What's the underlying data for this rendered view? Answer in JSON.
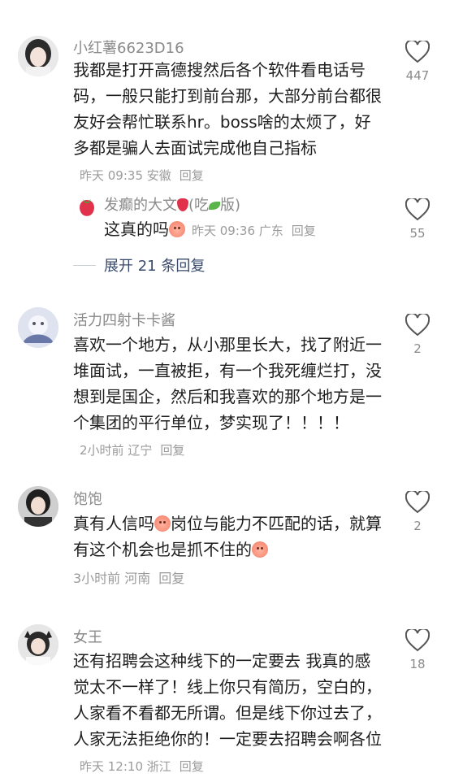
{
  "comments": [
    {
      "username": "小红薯6623D16",
      "text": "我都是打开高德搜然后各个软件看电话号码，一般只能打到前台那，大部分前台都很友好会帮忙联系hr。boss啥的太烦了，好多都是骗人去面试完成他自己指标",
      "time": "昨天 09:35",
      "location": "安徽",
      "reply_label": "回复",
      "likes": "447",
      "reply": {
        "username_prefix": "发癫的大文",
        "username_mid": "(吃",
        "username_suffix": "版)",
        "text": "这真的吗",
        "time": "昨天 09:36",
        "location": "广东",
        "reply_label": "回复",
        "likes": "55"
      },
      "expand_label": "展开 21 条回复"
    },
    {
      "username": "活力四射卡卡酱",
      "text": "喜欢一个地方，从小那里长大，找了附近一堆面试，一直被拒，有一个我死缠烂打，没想到是国企，然后和我喜欢的那个地方是一个集团的平行单位，梦实现了！！！！",
      "time": "2小时前",
      "location": "辽宁",
      "reply_label": "回复",
      "likes": "2"
    },
    {
      "username": "饱饱",
      "text_a": "真有人信吗",
      "text_b": "岗位与能力不匹配的话，就算有这个机会也是抓不住的",
      "time": "3小时前",
      "location": "河南",
      "reply_label": "回复",
      "likes": "2"
    },
    {
      "username": "女王",
      "text": "还有招聘会这种线下的一定要去 我真的感觉太不一样了！线上你只有简历，空白的，人家看不看都无所谓。但是线下你过去了，人家无法拒绝你的！一定要去招聘会啊各位",
      "time": "昨天 12:10",
      "location": "浙江",
      "reply_label": "回复",
      "likes": "18"
    }
  ]
}
